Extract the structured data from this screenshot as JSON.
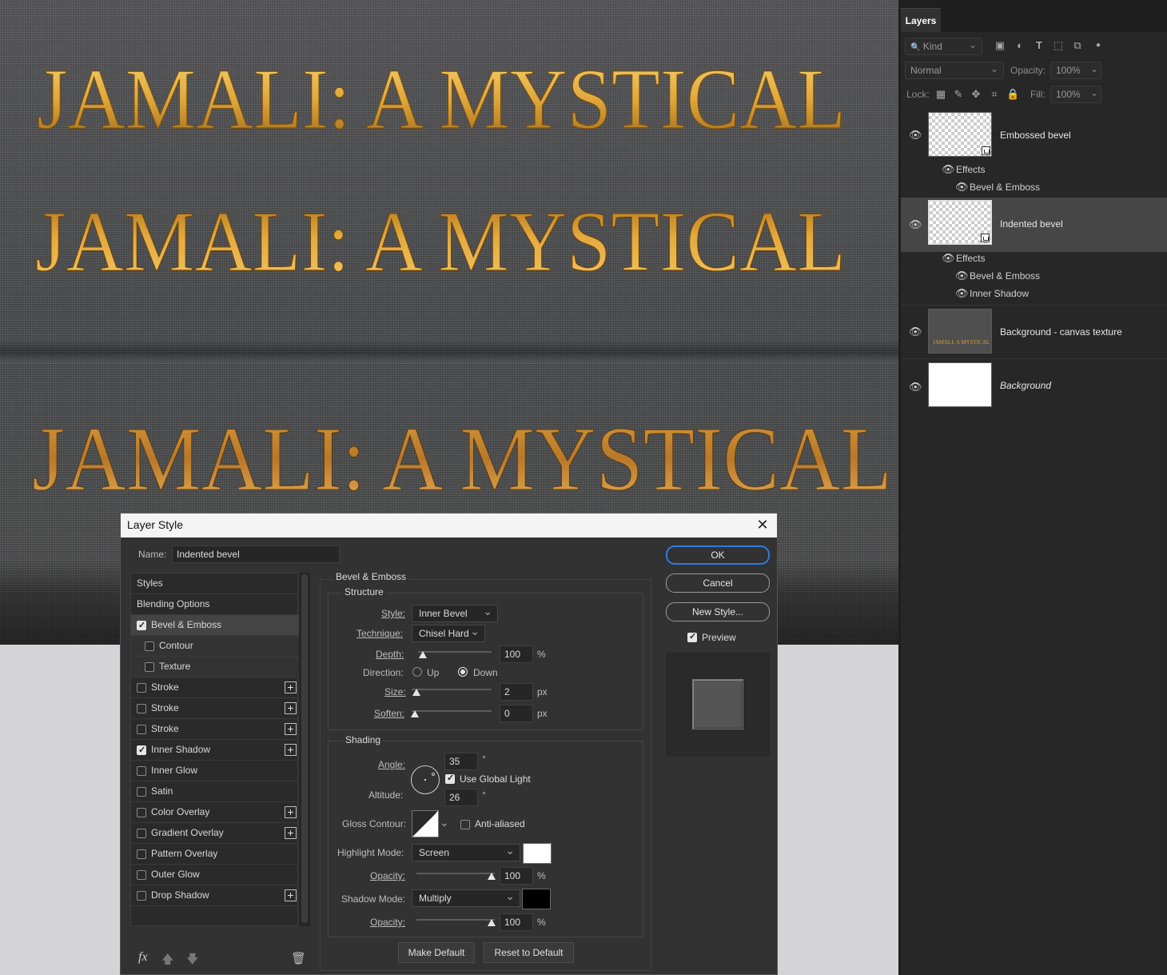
{
  "canvas": {
    "text_line": "JAMALI: A MYSTICAL",
    "colors": {
      "gold": "#e0a93a",
      "gold_light": "#f4cd6a",
      "gold_dark": "#8a5a12",
      "cloth": "#4f5051"
    }
  },
  "layers_panel": {
    "tab": "Layers",
    "filter_kind": "Kind",
    "blend_mode": "Normal",
    "opacity_label": "Opacity:",
    "opacity_value": "100%",
    "lock_label": "Lock:",
    "fill_label": "Fill:",
    "fill_value": "100%",
    "filter_icons": [
      "image-filter-icon",
      "adjustment-filter-icon",
      "type-filter-icon",
      "shape-filter-icon",
      "smart-object-filter-icon",
      "filter-toggle-icon"
    ],
    "lock_icons": [
      "lock-transparent-icon",
      "lock-image-icon",
      "lock-position-icon",
      "lock-artboard-icon",
      "lock-all-icon"
    ],
    "layers": [
      {
        "name": "Embossed bevel",
        "effects_label": "Effects",
        "effects": [
          "Bevel & Emboss"
        ]
      },
      {
        "name": "Indented bevel",
        "effects_label": "Effects",
        "effects": [
          "Bevel & Emboss",
          "Inner Shadow"
        ],
        "selected": true
      },
      {
        "name": "Background - canvas texture",
        "thumb_text": "JAMALI: A MYSTICAL"
      },
      {
        "name": "Background"
      }
    ]
  },
  "dialog": {
    "title": "Layer Style",
    "name_label": "Name:",
    "name_value": "Indented bevel",
    "styles_list": [
      {
        "label": "Styles"
      },
      {
        "label": "Blending Options"
      },
      {
        "label": "Bevel & Emboss",
        "checked": true
      },
      {
        "label": "Contour",
        "checked": false
      },
      {
        "label": "Texture",
        "checked": false
      },
      {
        "label": "Stroke",
        "checked": false,
        "plus": true
      },
      {
        "label": "Stroke",
        "checked": false,
        "plus": true
      },
      {
        "label": "Stroke",
        "checked": false,
        "plus": true
      },
      {
        "label": "Inner Shadow",
        "checked": true,
        "plus": true
      },
      {
        "label": "Inner Glow",
        "checked": false
      },
      {
        "label": "Satin",
        "checked": false
      },
      {
        "label": "Color Overlay",
        "checked": false,
        "plus": true
      },
      {
        "label": "Gradient Overlay",
        "checked": false,
        "plus": true
      },
      {
        "label": "Pattern Overlay",
        "checked": false
      },
      {
        "label": "Outer Glow",
        "checked": false
      },
      {
        "label": "Drop Shadow",
        "checked": false,
        "plus": true
      }
    ],
    "bottom_icons": [
      "fx-icon",
      "move-up-icon",
      "move-down-icon",
      "trash-icon"
    ],
    "bevel": {
      "section_title": "Bevel & Emboss",
      "structure_title": "Structure",
      "style_label": "Style:",
      "style_value": "Inner Bevel",
      "technique_label": "Technique:",
      "technique_value": "Chisel Hard",
      "depth_label": "Depth:",
      "depth_value": "100",
      "depth_unit": "%",
      "direction_label": "Direction:",
      "direction_up": "Up",
      "direction_down": "Down",
      "direction_selected": "Down",
      "size_label": "Size:",
      "size_value": "2",
      "size_unit": "px",
      "soften_label": "Soften:",
      "soften_value": "0",
      "soften_unit": "px",
      "shading_title": "Shading",
      "angle_label": "Angle:",
      "angle_value": "35",
      "degree": "°",
      "global_light_label": "Use Global Light",
      "global_light_checked": true,
      "altitude_label": "Altitude:",
      "altitude_value": "26",
      "gloss_label": "Gloss Contour:",
      "anti_aliased_label": "Anti-aliased",
      "anti_aliased_checked": false,
      "highlight_label": "Highlight Mode:",
      "highlight_value": "Screen",
      "highlight_color": "#ffffff",
      "hl_opacity_label": "Opacity:",
      "hl_opacity_value": "100",
      "shadow_label": "Shadow Mode:",
      "shadow_value": "Multiply",
      "shadow_color": "#000000",
      "sh_opacity_label": "Opacity:",
      "sh_opacity_value": "100",
      "percent": "%",
      "make_default": "Make Default",
      "reset_default": "Reset to Default"
    },
    "buttons": {
      "ok": "OK",
      "cancel": "Cancel",
      "new_style": "New Style...",
      "preview_label": "Preview",
      "preview_checked": true
    }
  }
}
